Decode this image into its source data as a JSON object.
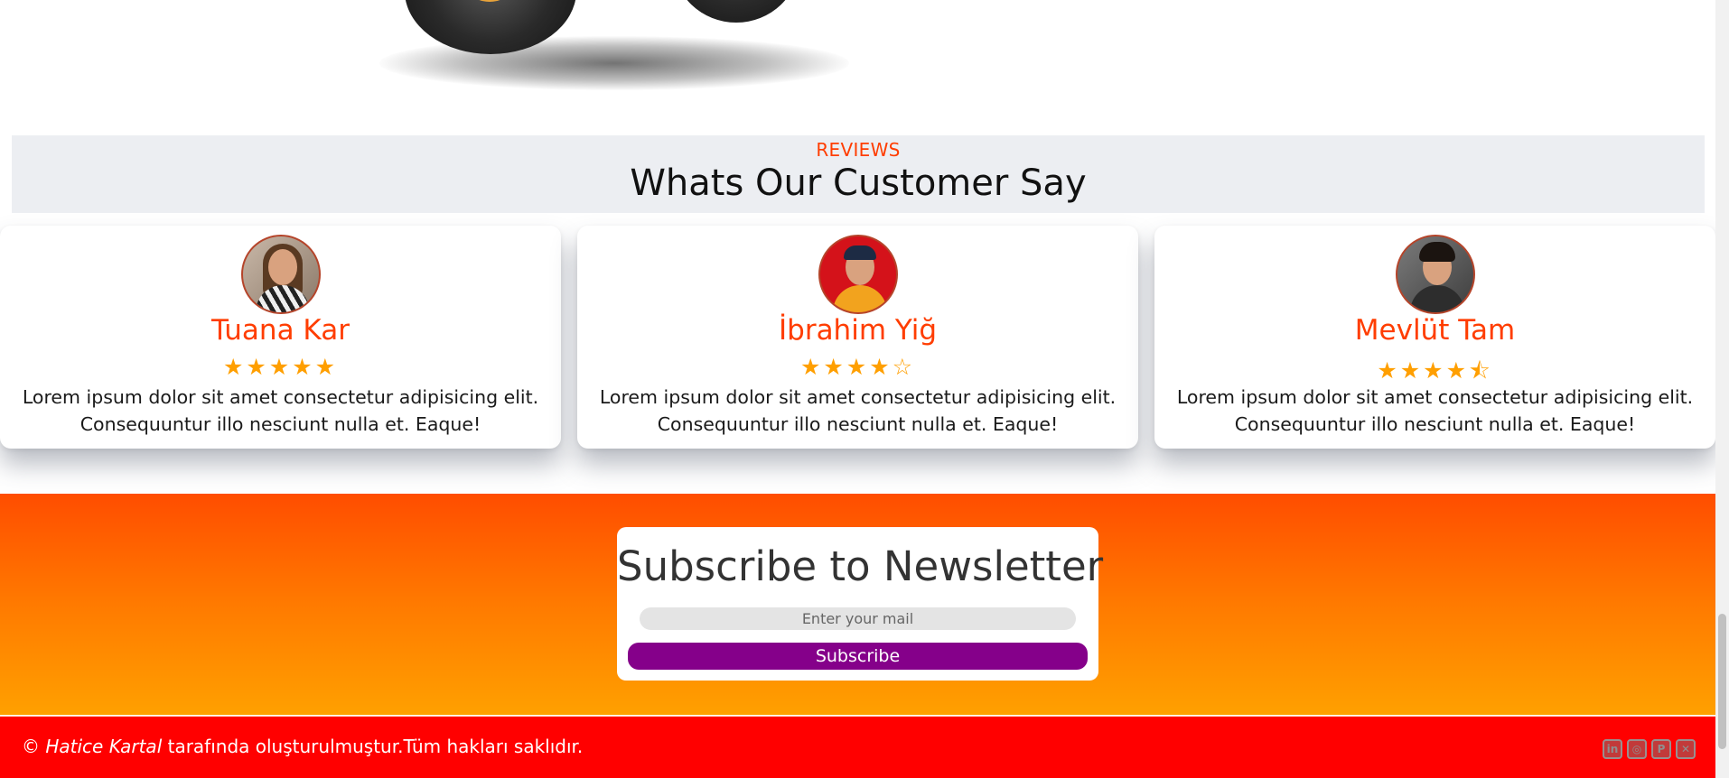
{
  "reviews": {
    "eyebrow": "REVIEWS",
    "title": "Whats Our Customer Say",
    "items": [
      {
        "name": "Tuana Kar",
        "rating": 5,
        "stars": "★★★★★",
        "text": "Lorem ipsum dolor sit amet consectetur adipisicing elit. Consequuntur illo nesciunt nulla et. Eaque!"
      },
      {
        "name": "İbrahim Yiğ",
        "rating": 4,
        "stars": "★★★★☆",
        "text": "Lorem ipsum dolor sit amet consectetur adipisicing elit. Consequuntur illo nesciunt nulla et. Eaque!"
      },
      {
        "name": "Mevlüt Tam",
        "rating": 4.5,
        "stars": "★★★★⯪",
        "text": "Lorem ipsum dolor sit amet consectetur adipisicing elit. Consequuntur illo nesciunt nulla et. Eaque!"
      }
    ]
  },
  "newsletter": {
    "title": "Subscribe to Newsletter",
    "email_placeholder": "Enter your mail",
    "button_label": "Subscribe"
  },
  "footer": {
    "copyright_symbol": "©",
    "author": "Hatice Kartal",
    "rest": "tarafında oluşturulmuştur.Tüm hakları saklıdır.",
    "social": [
      {
        "icon": "linkedin-icon",
        "glyph": "in"
      },
      {
        "icon": "instagram-icon",
        "glyph": "◎"
      },
      {
        "icon": "pinterest-icon",
        "glyph": "P"
      },
      {
        "icon": "x-icon",
        "glyph": "✕"
      }
    ]
  },
  "colors": {
    "accent": "#ff3d00",
    "star": "#ff9f00",
    "button": "#85008a",
    "footer": "#ff0000"
  }
}
